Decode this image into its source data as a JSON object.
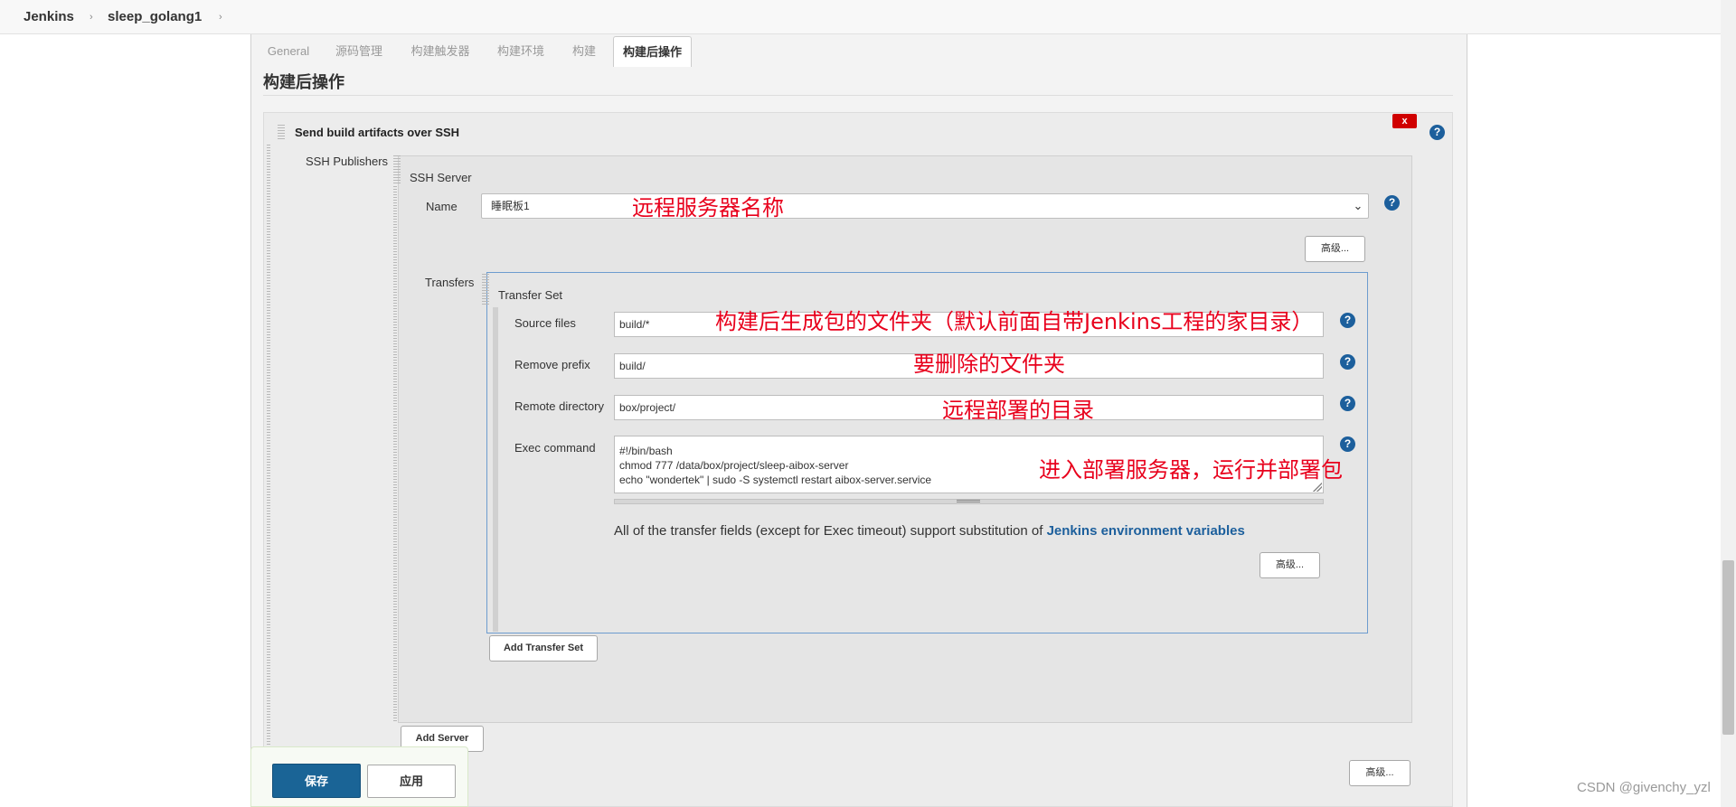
{
  "breadcrumb": {
    "root": "Jenkins",
    "job": "sleep_golang1"
  },
  "tabs": [
    {
      "label": "General"
    },
    {
      "label": "源码管理"
    },
    {
      "label": "构建触发器"
    },
    {
      "label": "构建环境"
    },
    {
      "label": "构建"
    },
    {
      "label": "构建后操作"
    }
  ],
  "active_tab": "构建后操作",
  "section": {
    "title": "构建后操作"
  },
  "publisher": {
    "title": "Send build artifacts over SSH",
    "close_label": "x",
    "ssh_publishers_label": "SSH Publishers",
    "ssh_server_label": "SSH Server",
    "name_label": "Name",
    "name_value": "睡眠板1",
    "advanced_label": "高级...",
    "transfers_label": "Transfers",
    "transfer_set_label": "Transfer Set",
    "fields": {
      "source_files": {
        "label": "Source files",
        "value": "build/*"
      },
      "remove_prefix": {
        "label": "Remove prefix",
        "value": "build/"
      },
      "remote_directory": {
        "label": "Remote directory",
        "value": "box/project/"
      },
      "exec_command": {
        "label": "Exec command",
        "lines": [
          "#!/bin/bash",
          "chmod 777 /data/box/project/sleep-aibox-server",
          "echo \"wondertek\" | sudo -S systemctl restart aibox-server.service"
        ]
      }
    },
    "hint_text": "All of the transfer fields (except for Exec timeout) support substitution of ",
    "hint_link": "Jenkins environment variables",
    "add_transfer_set_label": "Add Transfer Set",
    "add_server_label": "Add Server"
  },
  "annotations": {
    "server_name": "远程服务器名称",
    "source_files": "构建后生成包的文件夹（默认前面自带Jenkins工程的家目录）",
    "remove_prefix": "要删除的文件夹",
    "remote_directory": "远程部署的目录",
    "exec_command": "进入部署服务器，运行并部署包"
  },
  "footer": {
    "save_label": "保存",
    "apply_label": "应用"
  },
  "help_glyph": "?",
  "chevron_glyph": "⌄",
  "breadcrumb_sep_glyph": "›",
  "watermark": "CSDN @givenchy_yzl",
  "colors": {
    "accent_blue": "#1a6496",
    "link_blue": "#1c5f9c",
    "close_red": "#d00000",
    "annotation_red": "#e8001c",
    "transfer_border": "#6d9ccf"
  }
}
